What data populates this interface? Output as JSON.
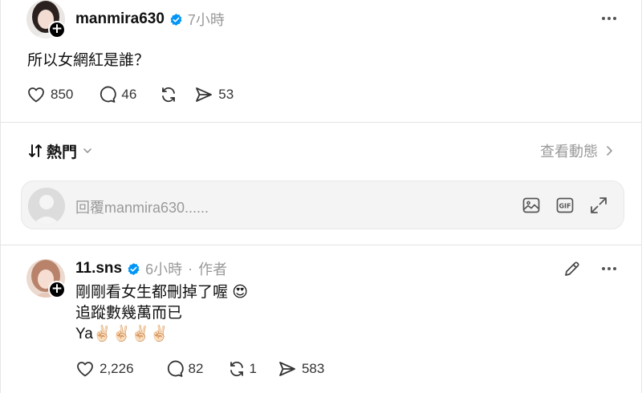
{
  "post": {
    "username": "manmira630",
    "timestamp": "7小時",
    "text": "所以女網紅是誰？",
    "likes": "850",
    "comments": "46",
    "shares": "53"
  },
  "sort": {
    "label": "熱門",
    "activity_link": "查看動態"
  },
  "reply_box": {
    "placeholder": "回覆manmira630......"
  },
  "reply": {
    "username": "11.sns",
    "timestamp": "6小時",
    "separator": "·",
    "author_tag": "作者",
    "lines": [
      "剛剛看女生都刪掉了喔 😍",
      "追蹤數幾萬而已",
      "Ya✌🏻✌🏻✌🏻✌🏻"
    ],
    "likes": "2,226",
    "comments": "82",
    "reposts": "1",
    "shares": "583"
  },
  "icons": {
    "verified": "verified-badge-icon",
    "like": "heart-icon",
    "comment": "comment-bubble-icon",
    "repost": "repost-arrows-icon",
    "share": "send-arrow-icon",
    "more": "more-dots-icon",
    "sort": "sort-arrows-icon",
    "edit": "pencil-icon",
    "image": "image-icon",
    "gif": "gif-icon",
    "expand": "expand-icon",
    "chevron": "chevron-icon"
  },
  "colors": {
    "verified_blue": "#0095f6",
    "muted_text": "#999999",
    "icon_stroke": "#333333"
  }
}
